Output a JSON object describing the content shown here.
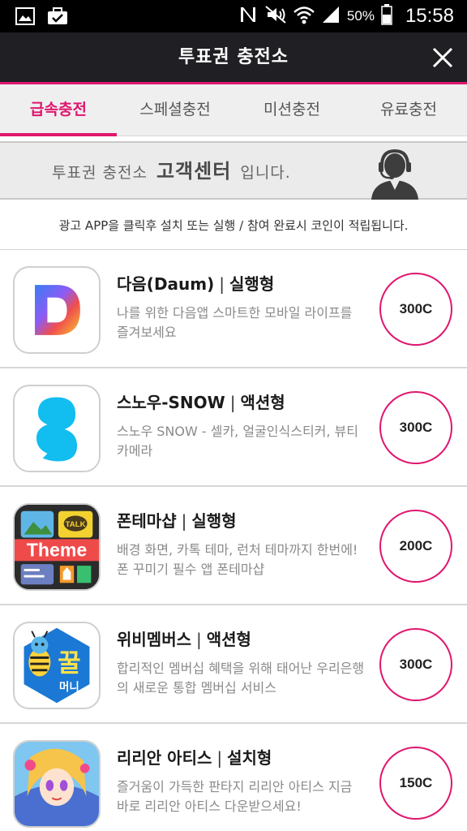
{
  "status_bar": {
    "battery_percent": "50%",
    "time": "15:58",
    "icons": [
      "image-icon",
      "briefcase-icon",
      "nfc-icon",
      "mute-icon",
      "wifi-icon",
      "signal-icon",
      "battery-icon"
    ]
  },
  "header": {
    "title": "투표권 충전소",
    "close_icon": "close-icon",
    "accent_color": "#e0166e"
  },
  "tabs": [
    {
      "label": "급속충전",
      "active": true
    },
    {
      "label": "스페셜충전",
      "active": false
    },
    {
      "label": "미션충전",
      "active": false
    },
    {
      "label": "유료충전",
      "active": false
    }
  ],
  "banner": {
    "prefix": "투표권 충전소",
    "emphasis": "고객센터",
    "suffix": "입니다.",
    "icon": "customer-service-agent-icon"
  },
  "notice": "광고 APP을 클릭후 설치 또는 실행 / 참여 완료시 코인이 적립됩니다.",
  "items": [
    {
      "name": "다음(Daum)",
      "type": "실행형",
      "desc": "나를 위한 다음앱 스마트한 모바일 라이프를 즐겨보세요",
      "coin": "300C",
      "icon": "daum-app-icon"
    },
    {
      "name": "스노우-SNOW",
      "type": "액션형",
      "desc": "스노우 SNOW - 셀카, 얼굴인식스티커, 뷰티카메라",
      "coin": "300C",
      "icon": "snow-app-icon"
    },
    {
      "name": "폰테마샵",
      "type": "실행형",
      "desc": "배경 화면, 카톡 테마, 런처 테마까지 한번에! 폰 꾸미기 필수 앱 폰테마샵",
      "coin": "200C",
      "icon": "theme-shop-app-icon",
      "icon_text": "Theme",
      "icon_badge": "TALK"
    },
    {
      "name": "위비멤버스",
      "type": "액션형",
      "desc": "합리적인 멤버십 혜택을 위해 태어난 우리은행의 새로운 통합 멤버십 서비스",
      "coin": "300C",
      "icon": "wibee-members-app-icon",
      "icon_text": "꿀",
      "icon_subtext": "머니"
    },
    {
      "name": "리리안 아티스",
      "type": "설치형",
      "desc": "즐거움이 가득한 판타지 리리안 아티스 지금 바로 리리안 아티스 다운받으세요!",
      "coin": "150C",
      "icon": "lilian-artis-app-icon"
    }
  ]
}
